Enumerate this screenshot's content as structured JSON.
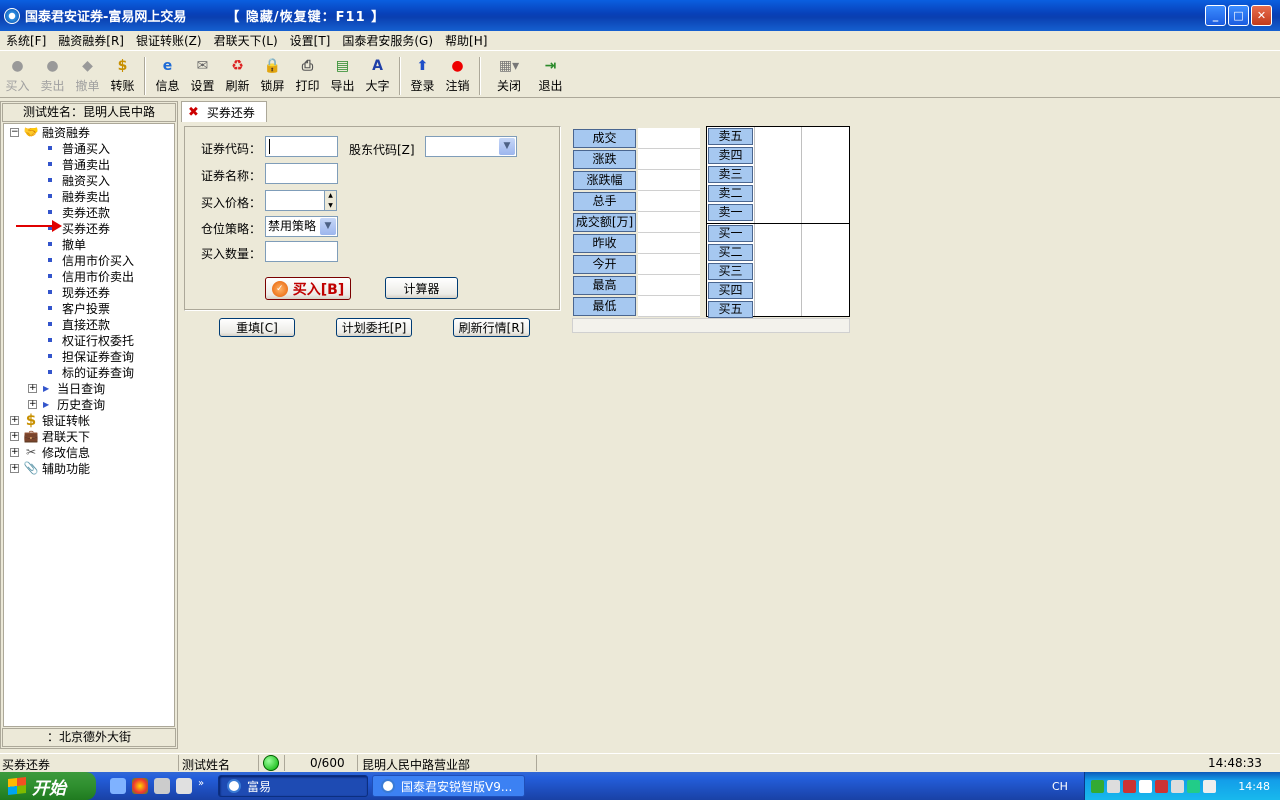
{
  "window": {
    "title": "国泰君安证券-富易网上交易",
    "hotkey_hint": "【 隐藏/恢复键：F11 】"
  },
  "menu": [
    "系统[F]",
    "融资融券[R]",
    "银证转账(Z)",
    "君联天下(L)",
    "设置[T]",
    "国泰君安服务(G)",
    "帮助[H]"
  ],
  "toolbar": {
    "disabled": [
      "买入",
      "卖出",
      "撤单"
    ],
    "transfer": "转账",
    "group2": [
      "信息",
      "设置",
      "刷新",
      "锁屏",
      "打印",
      "导出",
      "大字"
    ],
    "group3": [
      "登录",
      "注销"
    ],
    "close": "关闭",
    "exit": "退出"
  },
  "left_panel": {
    "header": "测试姓名：昆明人民中路",
    "footer": "：北京德外大街",
    "root": "融资融券",
    "items": [
      "普通买入",
      "普通卖出",
      "融资买入",
      "融券卖出",
      "卖券还款",
      "买券还券",
      "撤单",
      "信用市价买入",
      "信用市价卖出",
      "现券还券",
      "客户投票",
      "直接还款",
      "权证行权委托",
      "担保证券查询",
      "标的证券查询"
    ],
    "sub_groups": [
      "当日查询",
      "历史查询"
    ],
    "top_groups": [
      "银证转帐",
      "君联天下",
      "修改信息",
      "辅助功能"
    ]
  },
  "tab": {
    "label": "买券还券"
  },
  "form": {
    "code_label": "证券代码：",
    "holder_label": "股东代码[Z]",
    "name_label": "证券名称：",
    "price_label": "买入价格：",
    "strategy_label": "仓位策略：",
    "strategy_value": "禁用策略",
    "qty_label": "买入数量：",
    "buy_button": "买入[B]",
    "calc_button": "计算器",
    "reset_button": "重填[C]",
    "plan_button": "计划委托[P]",
    "refresh_button": "刷新行情[R]"
  },
  "quote": {
    "labels": [
      "成交",
      "涨跌",
      "涨跌幅",
      "总手",
      "成交额[万]",
      "昨收",
      "今开",
      "最高",
      "最低"
    ],
    "sell": [
      "卖五",
      "卖四",
      "卖三",
      "卖二",
      "卖一"
    ],
    "buy": [
      "买一",
      "买二",
      "买三",
      "买四",
      "买五"
    ]
  },
  "status": {
    "left": "买券还券",
    "user": "测试姓名",
    "count": "0/600",
    "branch": "昆明人民中路营业部",
    "time": "14:48:33"
  },
  "taskbar": {
    "start": "开始",
    "task1": "富易",
    "task2": "国泰君安锐智版V9...",
    "lang": "CH",
    "clock": "14:48"
  },
  "colors": {
    "accent_blue": "#A6C8F0",
    "title_blue": "#0A5FE0",
    "status_green": "#00B000"
  }
}
